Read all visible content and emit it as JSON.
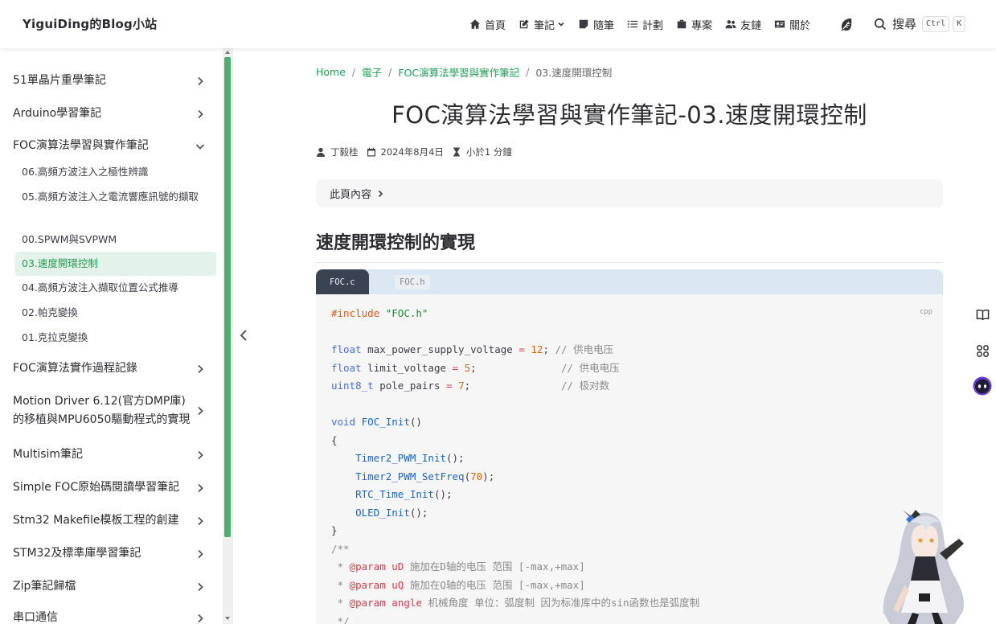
{
  "site": {
    "title": "YiguiDing的Blog小站"
  },
  "nav": {
    "items": [
      {
        "label": "首頁",
        "icon": "home-icon"
      },
      {
        "label": "筆記",
        "icon": "edit-icon",
        "dropdown": true
      },
      {
        "label": "隨筆",
        "icon": "note-icon"
      },
      {
        "label": "計劃",
        "icon": "list-icon"
      },
      {
        "label": "專案",
        "icon": "briefcase-icon"
      },
      {
        "label": "友鏈",
        "icon": "users-icon"
      },
      {
        "label": "關於",
        "icon": "id-card-icon"
      }
    ],
    "search_label": "搜尋",
    "kbd_ctrl": "Ctrl",
    "kbd_k": "K"
  },
  "sidebar": {
    "items": [
      {
        "label": "51單晶片重學筆記",
        "expanded": false
      },
      {
        "label": "Arduino學習筆記",
        "expanded": false
      },
      {
        "label": "FOC演算法學習與實作筆記",
        "expanded": true
      },
      {
        "label": "FOC演算法實作過程記錄",
        "expanded": false
      },
      {
        "label": "Motion Driver 6.12(官方DMP庫)的移植與MPU6050驅動程式的實現",
        "expanded": false
      },
      {
        "label": "Multisim筆記",
        "expanded": false
      },
      {
        "label": "Simple FOC原始碼閱讀學習筆記",
        "expanded": false
      },
      {
        "label": "Stm32 Makefile模板工程的創建",
        "expanded": false
      },
      {
        "label": "STM32及標準庫學習筆記",
        "expanded": false
      },
      {
        "label": "Zip筆記歸檔",
        "expanded": false
      },
      {
        "label": "串口通信",
        "expanded": false
      }
    ],
    "subitems": [
      {
        "label": "06.高頻方波注入之極性辨識",
        "active": false
      },
      {
        "label": "05.高頻方波注入之電流響應訊號的擷取",
        "active": false
      },
      {
        "label": "00.SPWM與SVPWM",
        "active": false
      },
      {
        "label": "03.速度開環控制",
        "active": true
      },
      {
        "label": "04.高頻方波注入擷取位置公式推導",
        "active": false
      },
      {
        "label": "02.帕克變換",
        "active": false
      },
      {
        "label": "01.克拉克變換",
        "active": false
      }
    ]
  },
  "breadcrumb": {
    "home": "Home",
    "level1": "電子",
    "level2": "FOC演算法學習與實作筆記",
    "current": "03.速度開環控制",
    "sep": "/"
  },
  "article": {
    "title": "FOC演算法學習與實作筆記-03.速度開環控制",
    "author": "丁毅桂",
    "date": "2024年8月4日",
    "read_time": "小於1 分鐘",
    "toc_label": "此頁內容",
    "h2": "速度開環控制的實現"
  },
  "code": {
    "tabs": [
      "FOC.c",
      "FOC.h"
    ],
    "active_tab": "FOC.c",
    "lang": "cpp",
    "include_kw": "#include",
    "include_file": "\"FOC.h\"",
    "vars": [
      {
        "type": "float",
        "name": "max_power_supply_voltage",
        "value": "12",
        "comment": "// 供电电压",
        "pad": " "
      },
      {
        "type": "float",
        "name": "limit_voltage",
        "value": "5",
        "comment": "// 供电电压",
        "pad": "              "
      },
      {
        "type": "uint8_t",
        "name": "pole_pairs",
        "value": "7",
        "comment": "// 极对数",
        "pad": "               "
      }
    ],
    "func_decl_type": "void",
    "func_decl_name": "FOC_Init",
    "calls": [
      {
        "name": "Timer2_PWM_Init",
        "arg": ""
      },
      {
        "name": "Timer2_PWM_SetFreq",
        "arg": "70"
      },
      {
        "name": "RTC_Time_Init",
        "arg": ""
      },
      {
        "name": "OLED_Init",
        "arg": ""
      }
    ],
    "doc_open": "/**",
    "params": [
      {
        "tag": "@param",
        "name": "uD",
        "desc": "施加在D轴的电压 范围 [-max,+max]"
      },
      {
        "tag": "@param",
        "name": "uQ",
        "desc": "施加在Q轴的电压 范围 [-max,+max]"
      },
      {
        "tag": "@param",
        "name": "angle",
        "desc": "机械角度 单位：弧度制 因为标准库中的sin函数也是弧度制"
      }
    ],
    "doc_close": " */"
  },
  "float_buttons": [
    "book-icon",
    "apps-icon",
    "chat-bot-icon"
  ],
  "colors": {
    "accent": "#1f9d55",
    "active_bg": "#e3f3e9",
    "scroll_thumb": "#4caf70"
  }
}
